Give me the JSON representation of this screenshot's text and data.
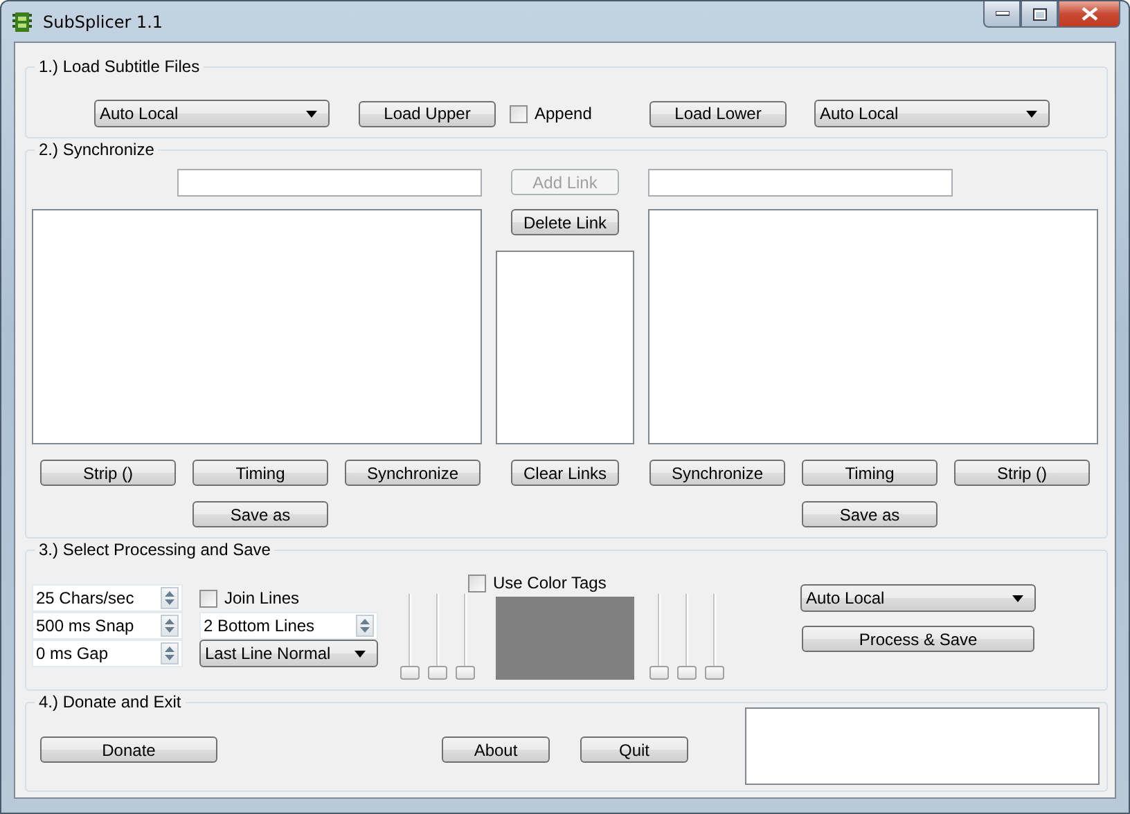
{
  "window": {
    "title": "SubSplicer 1.1"
  },
  "load_section": {
    "title": "1.) Load Subtitle Files",
    "upper_source": "Auto Local",
    "load_upper": "Load Upper",
    "append": {
      "label": "Append",
      "checked": false
    },
    "load_lower": "Load Lower",
    "lower_source": "Auto Local"
  },
  "sync_section": {
    "title": "2.) Synchronize",
    "add_link": {
      "label": "Add Link",
      "disabled": true
    },
    "delete_link": {
      "label": "Delete Link",
      "disabled": false
    },
    "left_buttons": [
      "Strip ()",
      "Timing",
      "Synchronize"
    ],
    "left_save": "Save as",
    "clear_links": "Clear Links",
    "right_buttons": [
      "Synchronize",
      "Timing",
      "Strip ()"
    ],
    "right_save": "Save as"
  },
  "process_section": {
    "title": "3.) Select Processing and Save",
    "spinners": [
      "25 Chars/sec",
      "500 ms Snap",
      "0 ms Gap"
    ],
    "join_lines": {
      "label": "Join Lines",
      "checked": false
    },
    "bottom_lines": "2 Bottom Lines",
    "last_line": "Last Line Normal",
    "color_tags": {
      "label": "Use Color Tags",
      "checked": false
    },
    "left_sliders": [
      {
        "level": 0
      },
      {
        "level": 0
      },
      {
        "level": 0
      }
    ],
    "right_sliders": [
      {
        "level": 0
      },
      {
        "level": 0
      },
      {
        "level": 0
      }
    ],
    "output_format": "Auto Local",
    "process_save": "Process & Save"
  },
  "exit_section": {
    "title": "4.) Donate and Exit",
    "donate": "Donate",
    "about": "About",
    "quit": "Quit"
  }
}
